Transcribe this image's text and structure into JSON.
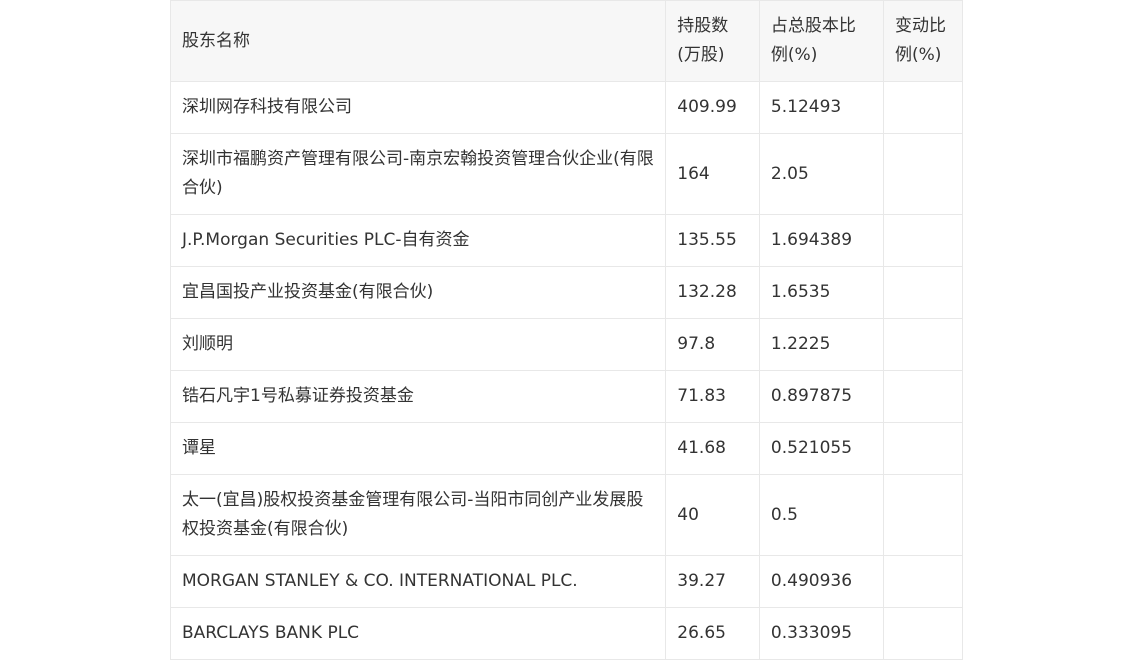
{
  "table": {
    "headers": {
      "name": "股东名称",
      "shares": "持股数(万股)",
      "percent": "占总股本比例(%)",
      "change": "变动比例(%)"
    },
    "rows": [
      {
        "name": "深圳网存科技有限公司",
        "shares": "409.99",
        "percent": "5.12493",
        "change": ""
      },
      {
        "name": "深圳市福鹏资产管理有限公司-南京宏翰投资管理合伙企业(有限合伙)",
        "shares": "164",
        "percent": "2.05",
        "change": ""
      },
      {
        "name": "J.P.Morgan Securities PLC-自有资金",
        "shares": "135.55",
        "percent": "1.694389",
        "change": ""
      },
      {
        "name": "宜昌国投产业投资基金(有限合伙)",
        "shares": "132.28",
        "percent": "1.6535",
        "change": ""
      },
      {
        "name": "刘顺明",
        "shares": "97.8",
        "percent": "1.2225",
        "change": ""
      },
      {
        "name": "锆石凡宇1号私募证券投资基金",
        "shares": "71.83",
        "percent": "0.897875",
        "change": ""
      },
      {
        "name": "谭星",
        "shares": "41.68",
        "percent": "0.521055",
        "change": ""
      },
      {
        "name": "太一(宜昌)股权投资基金管理有限公司-当阳市同创产业发展股权投资基金(有限合伙)",
        "shares": "40",
        "percent": "0.5",
        "change": ""
      },
      {
        "name": "MORGAN STANLEY & CO. INTERNATIONAL PLC.",
        "shares": "39.27",
        "percent": "0.490936",
        "change": ""
      },
      {
        "name": "BARCLAYS BANK PLC",
        "shares": "26.65",
        "percent": "0.333095",
        "change": ""
      }
    ]
  }
}
